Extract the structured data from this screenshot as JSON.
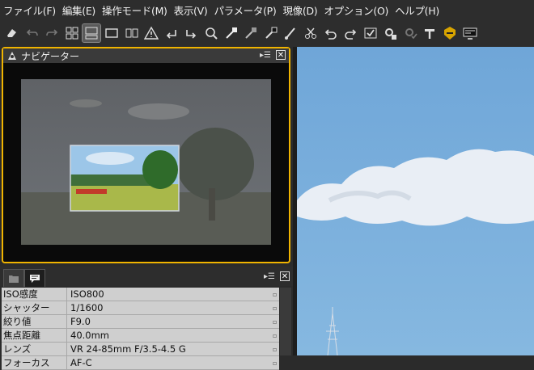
{
  "menu": [
    {
      "label": "ファイル(F)",
      "name": "menu-file"
    },
    {
      "label": "編集(E)",
      "name": "menu-edit"
    },
    {
      "label": "操作モード(M)",
      "name": "menu-mode"
    },
    {
      "label": "表示(V)",
      "name": "menu-view"
    },
    {
      "label": "パラメータ(P)",
      "name": "menu-parameters"
    },
    {
      "label": "現像(D)",
      "name": "menu-develop"
    },
    {
      "label": "オプション(O)",
      "name": "menu-options"
    },
    {
      "label": "ヘルプ(H)",
      "name": "menu-help"
    }
  ],
  "toolbar": [
    "eraser-icon",
    "undo-icon",
    "redo-icon",
    "grid-view-icon",
    "filmstrip-view-icon",
    "single-view-icon",
    "compare-view-icon",
    "warning-icon",
    "rotate-left-icon",
    "rotate-right-icon",
    "zoom-icon",
    "white-balance-picker-icon",
    "gray-point-picker-icon",
    "black-point-picker-icon",
    "brush-icon",
    "scissors-icon",
    "undo-edit-icon",
    "redo-edit-icon",
    "check-icon",
    "settings-icon",
    "batch-icon",
    "hammer-icon",
    "badge-icon",
    "monitor-icon"
  ],
  "navigator": {
    "title": "ナビゲーター",
    "menu_glyph": "▸☰",
    "close_glyph": "✕"
  },
  "info": {
    "menu_glyph": "▸☰",
    "close_glyph": "✕",
    "rows": [
      {
        "key": "ISO感度",
        "value": "ISO800"
      },
      {
        "key": "シャッター",
        "value": "1/1600"
      },
      {
        "key": "絞り値",
        "value": "F9.0"
      },
      {
        "key": "焦点距離",
        "value": "40.0mm"
      },
      {
        "key": "レンズ",
        "value": "VR 24-85mm F/3.5-4.5 G"
      },
      {
        "key": "フォーカス",
        "value": "AF-C"
      }
    ]
  },
  "colors": {
    "accent": "#f0b400",
    "sky": "#7fb2de"
  }
}
